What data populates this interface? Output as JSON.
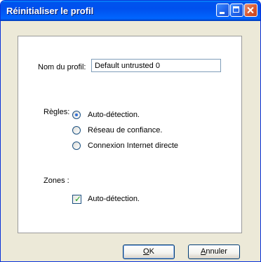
{
  "window": {
    "title": "Réinitialiser le profil",
    "controls": [
      "minimize-icon",
      "maximize-icon",
      "close-icon"
    ]
  },
  "profile": {
    "label": "Nom du profil:",
    "value": "Default untrusted 0"
  },
  "rules": {
    "label": "Règles:",
    "options": [
      {
        "label": "Auto-détection.",
        "selected": true
      },
      {
        "label": "Réseau de confiance.",
        "selected": false
      },
      {
        "label": "Connexion Internet directe",
        "selected": false
      }
    ]
  },
  "zones": {
    "label": "Zones :",
    "checkbox_label": "Auto-détection.",
    "checked": true
  },
  "buttons": {
    "ok_first": "O",
    "ok_rest": "K",
    "cancel_first": "A",
    "cancel_rest": "nnuler"
  }
}
